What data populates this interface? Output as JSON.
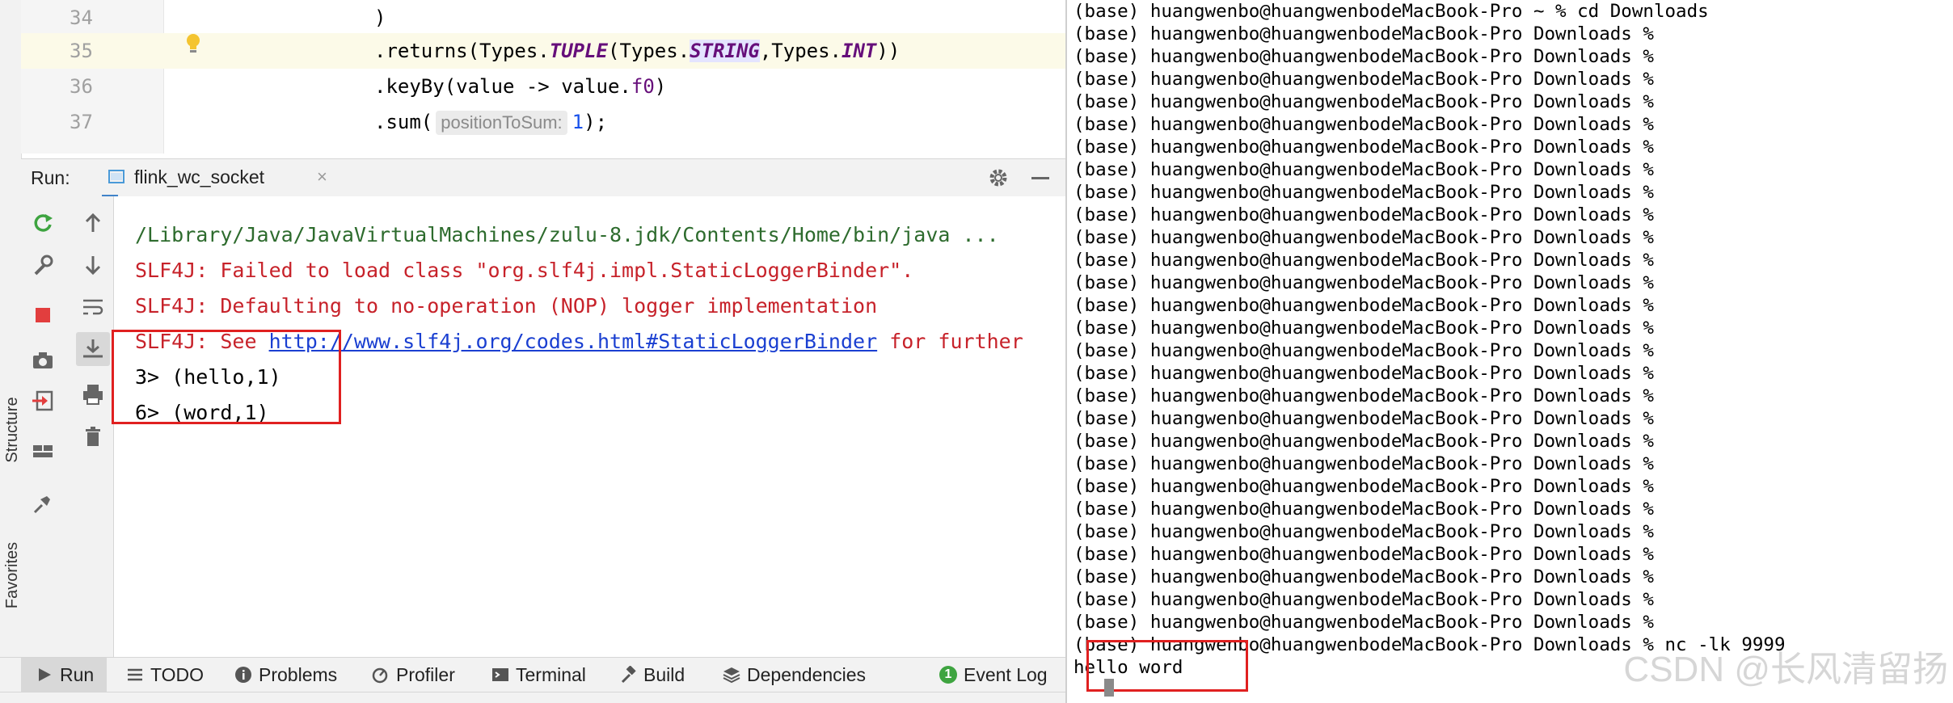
{
  "left_strip": {
    "structure_label": "Structure",
    "favorites_label": "Favorites"
  },
  "editor": {
    "lines": [
      {
        "number": "34",
        "text": ")"
      },
      {
        "number": "35",
        "prefix": ".returns(Types.",
        "tuple": "TUPLE",
        "mid1": "(Types.",
        "string": "STRING",
        "mid2": ",Types.",
        "int": "INT",
        "suffix": "))"
      },
      {
        "number": "36",
        "prefix": ".keyBy(value -> value.",
        "field": "f0",
        "suffix": ")"
      },
      {
        "number": "37",
        "prefix": ".sum(",
        "hint": "positionToSum:",
        "num": "1",
        "suffix": ");"
      }
    ]
  },
  "run_panel": {
    "title": "Run:",
    "tab_label": "flink_wc_socket",
    "close_glyph": "×"
  },
  "console": {
    "lines": [
      {
        "type": "path",
        "text": "/Library/Java/JavaVirtualMachines/zulu-8.jdk/Contents/Home/bin/java ..."
      },
      {
        "type": "err",
        "text": "SLF4J: Failed to load class \"org.slf4j.impl.StaticLoggerBinder\"."
      },
      {
        "type": "err",
        "text": "SLF4J: Defaulting to no-operation (NOP) logger implementation"
      },
      {
        "type": "err",
        "prefix": "SLF4J: See ",
        "link": "http://www.slf4j.org/codes.html#StaticLoggerBinder",
        "suffix": " for further"
      },
      {
        "type": "out",
        "text": "3> (hello,1)"
      },
      {
        "type": "out",
        "text": "6> (word,1)"
      }
    ]
  },
  "bottom_bar": {
    "tabs": [
      {
        "label": "Run",
        "icon": "run-icon",
        "active": true
      },
      {
        "label": "TODO",
        "icon": "list-icon"
      },
      {
        "label": "Problems",
        "icon": "info-icon"
      },
      {
        "label": "Profiler",
        "icon": "profiler-icon"
      },
      {
        "label": "Terminal",
        "icon": "terminal-icon"
      },
      {
        "label": "Build",
        "icon": "hammer-icon"
      },
      {
        "label": "Dependencies",
        "icon": "layers-icon"
      },
      {
        "label": "Event Log",
        "icon": "event-log-icon",
        "badge": "1"
      }
    ]
  },
  "terminal": {
    "first_line": "(base) huangwenbo@huangwenbodeMacBook-Pro ~ % cd Downloads",
    "repeated_prompt": "(base) huangwenbo@huangwenbodeMacBook-Pro Downloads %",
    "repeated_count": 27,
    "command_line": "(base) huangwenbo@huangwenbodeMacBook-Pro Downloads % nc -lk 9999",
    "input_line": "hello word"
  },
  "watermark": "CSDN @长风清留扬",
  "colors": {
    "highlight_box": "#e02020",
    "keyword": "#660e7a",
    "error_text": "#c7222a",
    "path_text": "#2d6b2d",
    "link": "#1a3fd1",
    "accent": "#4083c9"
  }
}
